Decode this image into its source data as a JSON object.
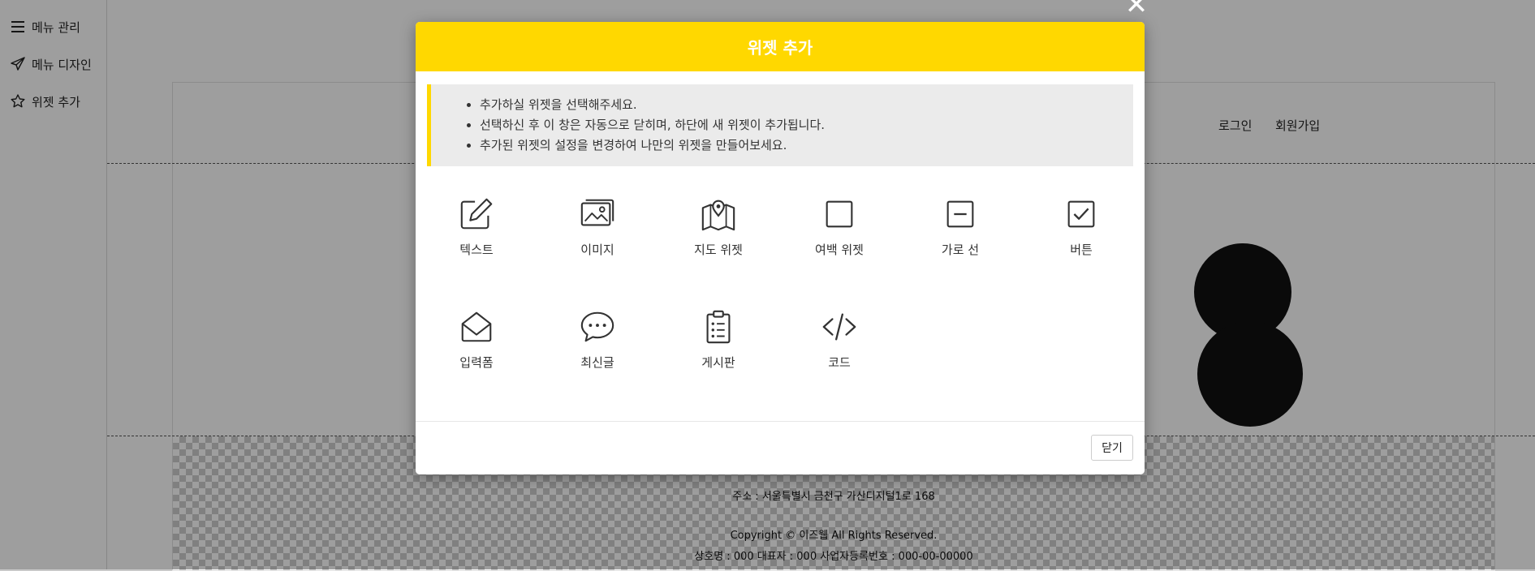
{
  "sidebar": {
    "items": [
      {
        "label": "메뉴 관리",
        "icon": "hamburger-icon"
      },
      {
        "label": "메뉴 디자인",
        "icon": "paper-plane-icon"
      },
      {
        "label": "위젯 추가",
        "icon": "star-icon"
      }
    ]
  },
  "page": {
    "nav": [
      "로그인",
      "회원가입"
    ],
    "footer": {
      "line1": "상호명 : 000 대표자 : 000 사업자등록번호 : 000-00-00000",
      "line2": "주소 : 서울특별시 금천구 가산디지털1로 168",
      "copyright": "Copyright © 이즈웹 All Rights Reserved."
    }
  },
  "modal": {
    "title": "위젯 추가",
    "notices": [
      "추가하실 위젯을 선택해주세요.",
      "선택하신 후 이 창은 자동으로 닫히며, 하단에 새 위젯이 추가됩니다.",
      "추가된 위젯의 설정을 변경하여 나만의 위젯을 만들어보세요."
    ],
    "widgets": [
      {
        "label": "텍스트",
        "icon": "pencil-edit-icon"
      },
      {
        "label": "이미지",
        "icon": "images-icon"
      },
      {
        "label": "지도 위젯",
        "icon": "map-pin-icon"
      },
      {
        "label": "여백 위젯",
        "icon": "empty-square-icon"
      },
      {
        "label": "가로 선",
        "icon": "minus-square-icon"
      },
      {
        "label": "버튼",
        "icon": "check-square-icon"
      },
      {
        "label": "입력폼",
        "icon": "envelope-open-icon"
      },
      {
        "label": "최신글",
        "icon": "chat-bubble-icon"
      },
      {
        "label": "게시판",
        "icon": "clipboard-list-icon"
      },
      {
        "label": "코드",
        "icon": "code-icon"
      }
    ],
    "close_label": "닫기"
  },
  "colors": {
    "accent": "#ffd800",
    "overlay": "#000000"
  }
}
